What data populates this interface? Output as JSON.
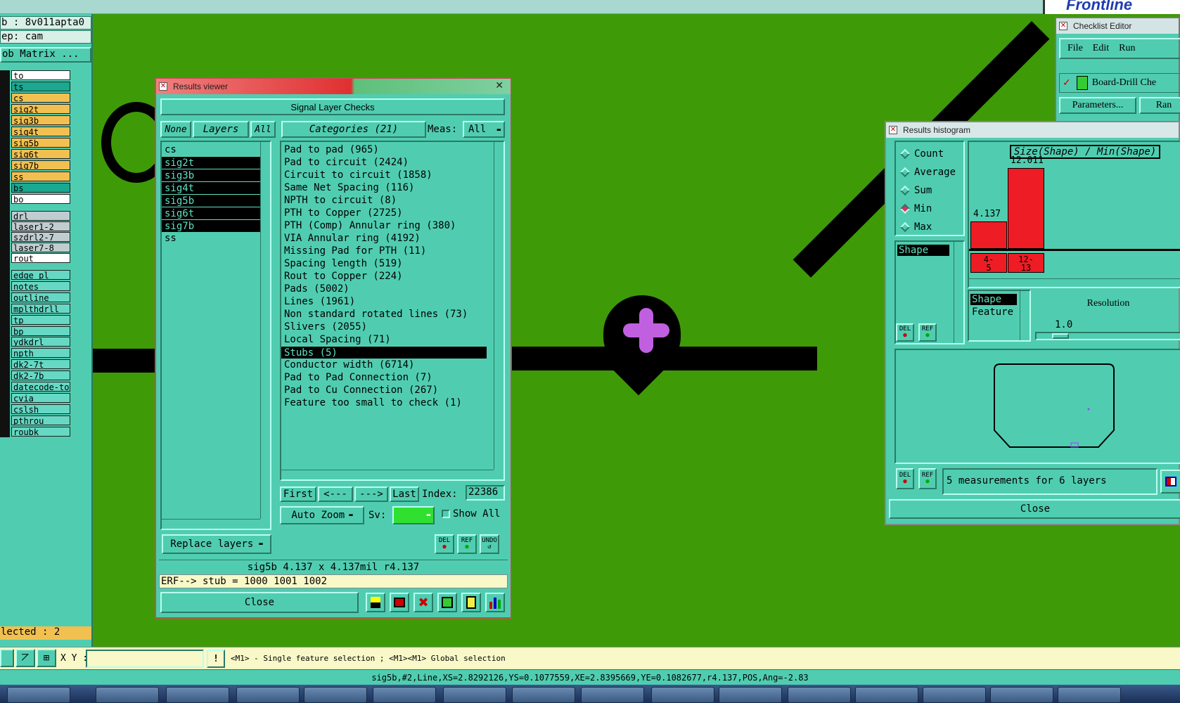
{
  "left_panel": {
    "job_line": "b : 8v011apta0",
    "step_line": "ep: cam",
    "matrix_button": "ob Matrix ...",
    "layers": [
      {
        "name": "to",
        "color": "#ffffff"
      },
      {
        "name": "ts",
        "color": "#1aa890"
      },
      {
        "name": "cs",
        "color": "#f2c050"
      },
      {
        "name": "sig2t",
        "color": "#f2c050"
      },
      {
        "name": "sig3b",
        "color": "#f2c050"
      },
      {
        "name": "sig4t",
        "color": "#f2c050"
      },
      {
        "name": "sig5b",
        "color": "#f2c050"
      },
      {
        "name": "sig6t",
        "color": "#f2c050"
      },
      {
        "name": "sig7b",
        "color": "#f2c050"
      },
      {
        "name": "ss",
        "color": "#f2c050"
      },
      {
        "name": "bs",
        "color": "#1aa890"
      },
      {
        "name": "bo",
        "color": "#ffffff"
      }
    ],
    "drill_layers": [
      "drl",
      "laser1-2",
      "szdrl2-7",
      "laser7-8",
      "rout"
    ],
    "doc_layers": [
      "edge_pl",
      "notes",
      "outline",
      "mplthdrll",
      "tp",
      "bp",
      "ydkdrl",
      "npth",
      "dk2-7t",
      "dk2-7b",
      "datecode-to",
      "cvia",
      "cslsh",
      "pthrou",
      "roubk"
    ],
    "selected_line": "lected : 2"
  },
  "results_viewer": {
    "title": "Results viewer",
    "heading": "Signal Layer Checks",
    "none_btn": "None",
    "layers_btn": "Layers",
    "all_btn": "All",
    "categories_btn": "Categories (21)",
    "meas_label": "Meas:",
    "meas_value": "All",
    "layer_list": [
      {
        "name": "cs",
        "selected": false
      },
      {
        "name": "sig2t",
        "selected": true
      },
      {
        "name": "sig3b",
        "selected": true
      },
      {
        "name": "sig4t",
        "selected": true
      },
      {
        "name": "sig5b",
        "selected": true
      },
      {
        "name": "sig6t",
        "selected": true
      },
      {
        "name": "sig7b",
        "selected": true
      },
      {
        "name": "ss",
        "selected": false
      }
    ],
    "categories": [
      {
        "label": "Pad to pad (965)",
        "selected": false
      },
      {
        "label": "Pad to circuit (2424)",
        "selected": false
      },
      {
        "label": "Circuit to circuit (1858)",
        "selected": false
      },
      {
        "label": "Same Net Spacing (116)",
        "selected": false
      },
      {
        "label": "NPTH to circuit (8)",
        "selected": false
      },
      {
        "label": "PTH to Copper (2725)",
        "selected": false
      },
      {
        "label": "PTH (Comp) Annular ring (380)",
        "selected": false
      },
      {
        "label": "VIA Annular ring (4192)",
        "selected": false
      },
      {
        "label": "Missing Pad for PTH (11)",
        "selected": false
      },
      {
        "label": "Spacing length (519)",
        "selected": false
      },
      {
        "label": "Rout to Copper (224)",
        "selected": false
      },
      {
        "label": "Pads (5002)",
        "selected": false
      },
      {
        "label": "Lines (1961)",
        "selected": false
      },
      {
        "label": "Non standard rotated lines (73)",
        "selected": false
      },
      {
        "label": "Slivers (2055)",
        "selected": false
      },
      {
        "label": "Local Spacing (71)",
        "selected": false
      },
      {
        "label": "Stubs (5)",
        "selected": true
      },
      {
        "label": "Conductor width (6714)",
        "selected": false
      },
      {
        "label": "Pad to Pad Connection (7)",
        "selected": false
      },
      {
        "label": "Pad to Cu Connection (267)",
        "selected": false
      },
      {
        "label": "Feature too small to check (1)",
        "selected": false
      }
    ],
    "first_btn": "First",
    "prev_btn": "<---",
    "next_btn": "--->",
    "last_btn": "Last",
    "index_label": "Index:",
    "index_value": "22386",
    "autozoom_btn": "Auto Zoom",
    "sv_label": "Sv:",
    "show_all_label": "Show All",
    "replace_btn": "Replace layers",
    "del_label": "DEL",
    "ref_label": "REF",
    "undo_label": "UNDO",
    "feature_info": "sig5b 4.137 x 4.137mil  r4.137",
    "erf_line": "ERF--> stub = 1000 1001 1002",
    "close_btn": "Close"
  },
  "checklist_editor": {
    "title": "Checklist Editor",
    "menu": [
      "File",
      "Edit",
      "Run"
    ],
    "item": "Board-Drill Che",
    "params_btn": "Parameters...",
    "ran_btn": "Ran"
  },
  "histogram": {
    "title": "Results histogram",
    "modes": [
      {
        "label": "Count",
        "on": false
      },
      {
        "label": "Average",
        "on": false
      },
      {
        "label": "Sum",
        "on": false
      },
      {
        "label": "Min",
        "on": true
      },
      {
        "label": "Max",
        "on": false
      }
    ],
    "shape_item": "Shape",
    "chart_title": "Size(Shape) / Min(Shape)",
    "bars": [
      {
        "label": "4.137",
        "value": 4.137,
        "range": "4-\n5"
      },
      {
        "label": "12.011",
        "value": 12.011,
        "range": "12-\n13"
      }
    ],
    "group_list": [
      "Shape",
      "Feature"
    ],
    "resolution_label": "Resolution",
    "resolution_value": "1.0",
    "summary": "5 measurements for 6 layers",
    "close_btn": "Close"
  },
  "command_bar": {
    "xy_label": "X Y :",
    "xy_value": "",
    "hint": "<M1> - Single feature selection ; <M1><M1> Global selection"
  },
  "status_line": "sig5b,#2,Line,XS=2.8292126,YS=0.1077559,XE=2.8395669,YE=0.1082677,r4.137,POS,Ang=-2.83",
  "top": {
    "brand": "Frontline"
  }
}
